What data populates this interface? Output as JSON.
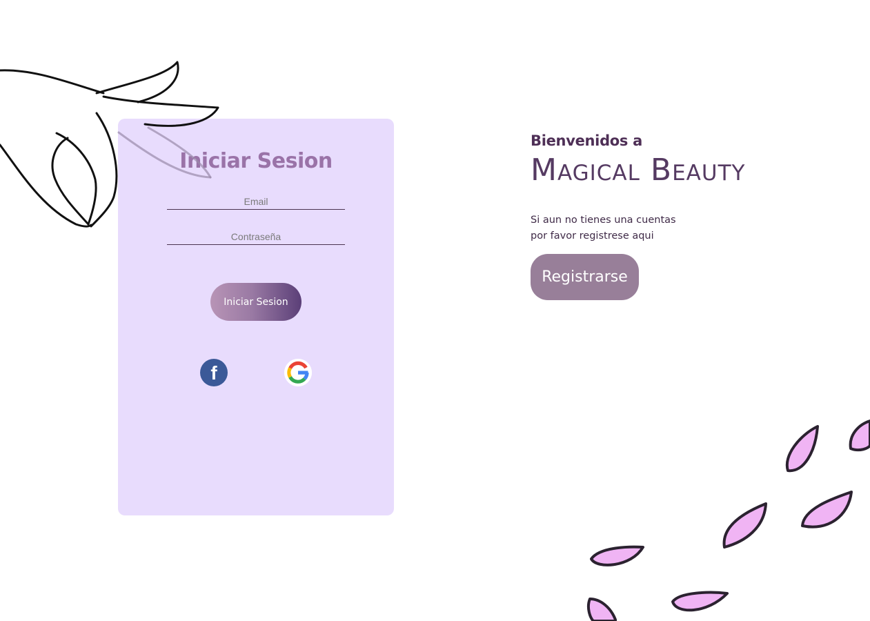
{
  "login": {
    "title": "Iniciar Sesion",
    "email_placeholder": "Email",
    "password_placeholder": "Contraseña",
    "submit_label": "Iniciar Sesion",
    "social": {
      "facebook_glyph": "f",
      "facebook_icon": "facebook-icon",
      "google_icon": "google-icon"
    }
  },
  "welcome": {
    "pre": "Bienvenidos a",
    "brand": "Magical Beauty",
    "line1": "Si aun no tienes una cuentas",
    "line2": "por favor registrese aqui",
    "register_label": "Registrarse"
  },
  "colors": {
    "card_bg": "#e8dcfd",
    "title": "#9a73a8",
    "brand": "#553a62",
    "register_bg": "#987f99",
    "petal_fill": "#f0b4f4",
    "facebook": "#3b5998"
  }
}
